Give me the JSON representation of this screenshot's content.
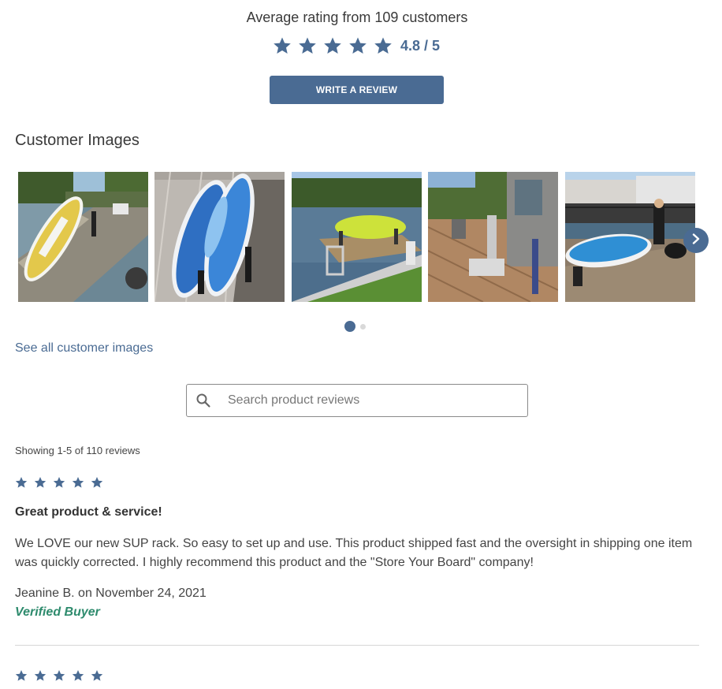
{
  "summary": {
    "average_label": "Average rating from 109 customers",
    "rating_text": "4.8 / 5",
    "rating_value": 4.8,
    "rating_max": 5,
    "star_color": "#4a6b93"
  },
  "write_review": {
    "label": "WRITE A REVIEW"
  },
  "customer_images": {
    "title": "Customer Images",
    "see_all_label": "See all customer images",
    "carousel_pages": 2,
    "active_page": 1
  },
  "search": {
    "placeholder": "Search product reviews"
  },
  "reviews": {
    "showing_text": "Showing 1-5 of 110 reviews",
    "items": [
      {
        "stars": 5,
        "title": "Great product & service!",
        "body": "We LOVE our new SUP rack. So easy to set up and use. This product shipped fast and the oversight in shipping one item was quickly corrected. I highly recommend this product and the \"Store Your Board\" company!",
        "author": "Jeanine B. on November 24, 2021",
        "badge": "Verified Buyer"
      },
      {
        "stars": 5
      }
    ]
  },
  "colors": {
    "accent": "#4a6b93",
    "verified": "#2e8b6d",
    "divider": "#d6d6d6"
  },
  "icons": {
    "star": "star-icon",
    "search": "search-icon",
    "next": "chevron-right-icon"
  }
}
